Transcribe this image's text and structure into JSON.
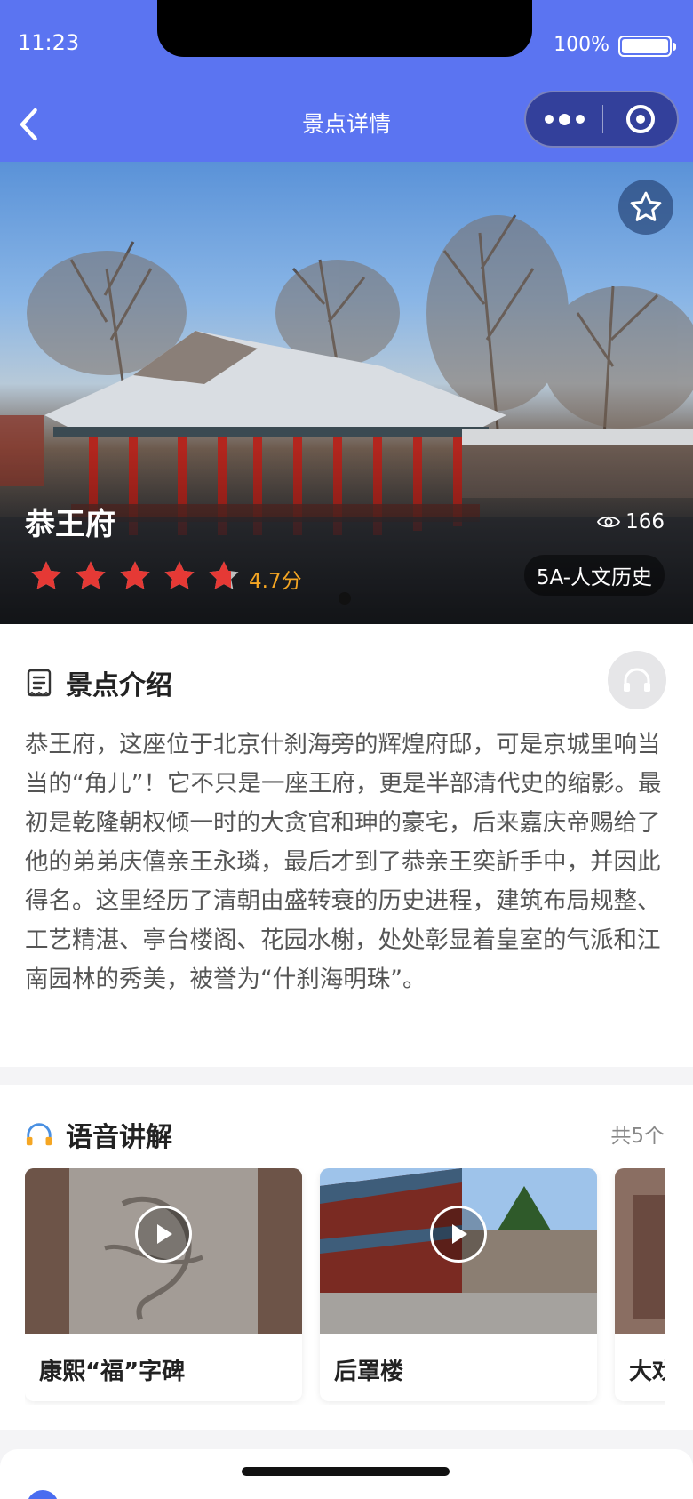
{
  "status": {
    "time": "11:23",
    "battery": "100%"
  },
  "nav": {
    "title": "景点详情"
  },
  "hero": {
    "name": "恭王府",
    "views": "166",
    "rating": 4.7,
    "score_text": "4.7分",
    "tag": "5A-人文历史"
  },
  "intro": {
    "title": "景点介绍",
    "text": "恭王府，这座位于北京什刹海旁的辉煌府邸，可是京城里响当当的“角儿”！它不只是一座王府，更是半部清代史的缩影。最初是乾隆朝权倾一时的大贪官和珅的豪宅，后来嘉庆帝赐给了他的弟弟庆僖亲王永璘，最后才到了恭亲王奕訢手中，并因此得名。这里经历了清朝由盛转衰的历史进程，建筑布局规整、工艺精湛、亭台楼阁、花园水榭，处处彰显着皇室的气派和江南园林的秀美，被誉为“什刹海明珠”。"
  },
  "guide": {
    "title": "语音讲解",
    "count": "共5个",
    "items": [
      {
        "title": "康熙“福”字碑"
      },
      {
        "title": "后罩楼"
      },
      {
        "title": "大戏"
      }
    ]
  },
  "colors": {
    "primary": "#5b74f1",
    "star": "#e53935",
    "score": "#f5a623"
  }
}
